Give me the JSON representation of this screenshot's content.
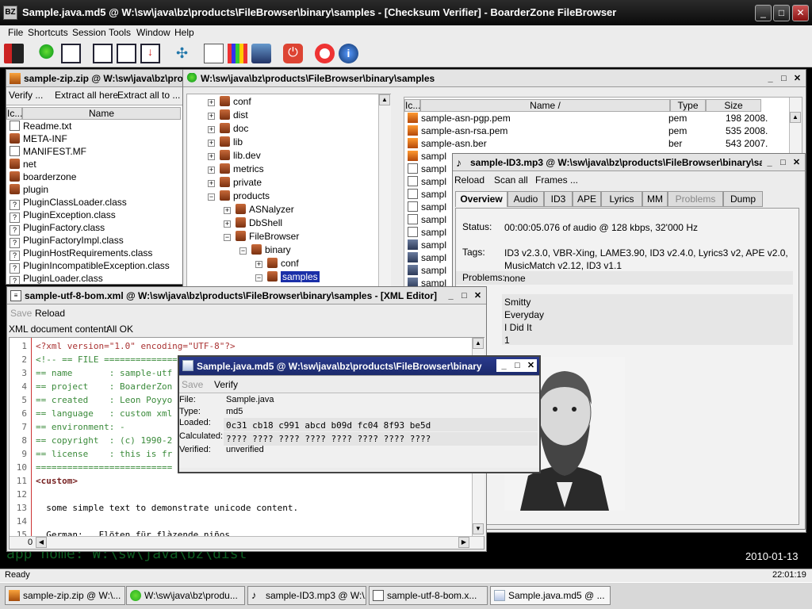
{
  "window": {
    "title": "Sample.java.md5 @ W:\\sw\\java\\bz\\products\\FileBrowser\\binary\\samples - [Checksum Verifier] - BoarderZone FileBrowser",
    "app_icon": "BZ"
  },
  "menu": [
    "File",
    "Shortcuts",
    "Session",
    "Tools",
    "Window",
    "Help"
  ],
  "desktop": {
    "app_home": "app home: W:\\sw\\java\\bz\\dist",
    "date": "2010-01-13"
  },
  "status": {
    "text": "Ready",
    "time": "22:01:19"
  },
  "taskbar": [
    "sample-zip.zip @ W:\\...",
    "W:\\sw\\java\\bz\\produ...",
    "sample-ID3.mp3 @ W:\\...",
    "sample-utf-8-bom.x...",
    "Sample.java.md5 @ ..."
  ],
  "zip": {
    "title": "sample-zip.zip @ W:\\sw\\java\\bz\\pro",
    "toolbar": {
      "verify": "Verify ...",
      "extract_here": "Extract all here",
      "extract_to": "Extract all to ..."
    },
    "columns": {
      "icon": "Ic...",
      "name": "Name"
    },
    "items": [
      "Readme.txt",
      "META-INF",
      "MANIFEST.MF",
      "net",
      "boarderzone",
      "plugin",
      "PluginClassLoader.class",
      "PluginException.class",
      "PluginFactory.class",
      "PluginFactoryImpl.class",
      "PluginHostRequirements.class",
      "PluginIncompatibleException.class",
      "PluginLoader.class"
    ]
  },
  "browser": {
    "title": "W:\\sw\\java\\bz\\products\\FileBrowser\\binary\\samples",
    "tree": [
      "conf",
      "dist",
      "doc",
      "lib",
      "lib.dev",
      "metrics",
      "private",
      "products",
      "ASNalyzer",
      "DbShell",
      "FileBrowser",
      "binary",
      "conf",
      "samples"
    ],
    "columns": {
      "icon": "Ic...",
      "name": "Name /",
      "type": "Type",
      "size": "Size"
    },
    "files": [
      {
        "name": "sample-asn-pgp.pem",
        "type": "pem",
        "size": "198 2008."
      },
      {
        "name": "sample-asn-rsa.pem",
        "type": "pem",
        "size": "535 2008."
      },
      {
        "name": "sample-asn.ber",
        "type": "ber",
        "size": "543 2007."
      }
    ],
    "partial_files": [
      "sampl",
      "sampl",
      "sampl",
      "sampl",
      "sampl",
      "sampl",
      "sampl",
      "sampl",
      "sampl",
      "sampl",
      "sampl",
      "sampl"
    ]
  },
  "mp3": {
    "title": "sample-ID3.mp3 @ W:\\sw\\java\\bz\\products\\FileBrowser\\binary\\sar",
    "toolbar": {
      "reload": "Reload",
      "scan": "Scan all",
      "frames": "Frames ..."
    },
    "tabs": [
      "Overview",
      "Audio",
      "ID3",
      "APE",
      "Lyrics",
      "MM",
      "Problems",
      "Dump"
    ],
    "status_label": "Status:",
    "status_value": "00:00:05.076 of audio @ 128 kbps, 32'000 Hz",
    "tags_label": "Tags:",
    "tags_line1": "ID3 v2.3.0, VBR-Xing, LAME3.90, ID3 v2.4.0, Lyrics3 v2, APE v2.0,",
    "tags_line2": "MusicMatch v2.12, ID3 v1.1",
    "problems_label": "Problems:",
    "problems_value": "none",
    "artist": "Smitty",
    "album": "Everyday",
    "track": "I Did It",
    "number": "1"
  },
  "xml": {
    "title": "sample-utf-8-bom.xml @ W:\\sw\\java\\bz\\products\\FileBrowser\\binary\\samples - [XML Editor]",
    "toolbar": {
      "save": "Save",
      "reload": "Reload"
    },
    "doc_label": "XML document content:",
    "doc_status": "All OK",
    "line_numbers": [
      "1",
      "2",
      "3",
      "4",
      "5",
      "6",
      "7",
      "8",
      "9",
      "10",
      "11",
      "12",
      "13",
      "14",
      "15"
    ],
    "lines": [
      "<?xml version=\"1.0\" encoding=\"UTF-8\"?>",
      "<!-- == FILE ==============",
      "== name       : sample-utf",
      "== project    : BoarderZon",
      "== created    : Leon Poyyo",
      "== language   : custom xml",
      "== environment: -",
      "== copyright  : (c) 1990-2",
      "== license    : this is fr",
      "==========================",
      "<custom>",
      "",
      "  some simple text to demonstrate unicode content.",
      "",
      "  German:   Flöten für flàzende niños"
    ],
    "hscroll_pos": "0"
  },
  "md5": {
    "title": "Sample.java.md5 @ W:\\sw\\java\\bz\\products\\FileBrowser\\binary",
    "toolbar": {
      "save": "Save",
      "verify": "Verify"
    },
    "file_label": "File:",
    "file": "Sample.java",
    "type_label": "Type:",
    "type": "md5",
    "loaded_label": "Loaded:",
    "loaded": "0c31 cb18 c991 abcd b09d fc04 8f93 be5d",
    "calc_label": "Calculated:",
    "calc": "???? ???? ???? ???? ???? ???? ???? ????",
    "verified_label": "Verified:",
    "verified": "unverified"
  }
}
